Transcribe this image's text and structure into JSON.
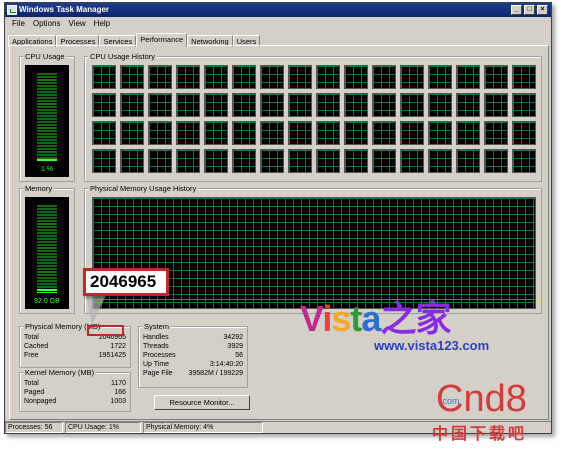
{
  "window": {
    "title": "Windows Task Manager"
  },
  "menu": [
    "File",
    "Options",
    "View",
    "Help"
  ],
  "tabs": [
    {
      "label": "Applications",
      "active": false
    },
    {
      "label": "Processes",
      "active": false
    },
    {
      "label": "Services",
      "active": false
    },
    {
      "label": "Performance",
      "active": true
    },
    {
      "label": "Networking",
      "active": false
    },
    {
      "label": "Users",
      "active": false
    }
  ],
  "cpu": {
    "label": "CPU Usage",
    "value": "1 %",
    "level": 0.01,
    "history_label": "CPU Usage History"
  },
  "memory": {
    "label": "Memory",
    "value": "92.0 GB",
    "level": 0.04,
    "history_label": "Physical Memory Usage History"
  },
  "physical": {
    "label": "Physical Memory (MB)",
    "rows": [
      {
        "name": "Total",
        "value": "2046965"
      },
      {
        "name": "Cached",
        "value": "1722"
      },
      {
        "name": "Free",
        "value": "1951425"
      }
    ]
  },
  "kernel": {
    "label": "Kernel Memory (MB)",
    "rows": [
      {
        "name": "Total",
        "value": "1170"
      },
      {
        "name": "Paged",
        "value": "166"
      },
      {
        "name": "Nonpaged",
        "value": "1003"
      }
    ]
  },
  "system": {
    "label": "System",
    "rows": [
      {
        "name": "Handles",
        "value": "34292"
      },
      {
        "name": "Threads",
        "value": "3929"
      },
      {
        "name": "Processes",
        "value": "56"
      },
      {
        "name": "Up Time",
        "value": "3:14:40:20"
      },
      {
        "name": "Page File",
        "value": "39582M / 199229"
      }
    ]
  },
  "resource_monitor_button": "Resource Monitor...",
  "callout": "2046965",
  "status": {
    "processes": "Processes: 56",
    "cpu": "CPU Usage: 1%",
    "memory": "Physical Memory: 4%"
  },
  "watermark": {
    "vista_logo": "Vista之家",
    "vista_url": "www.vista123.com",
    "cnd8_logo": "Cnd8",
    "cnd8_com": ".com",
    "cnd8_cn": "中国下载吧"
  },
  "colors": {
    "graph_grid": "#0a7a3a",
    "meter": "#3cff3c",
    "callout_border": "#c0282d",
    "title_bar": "#0a246a"
  }
}
